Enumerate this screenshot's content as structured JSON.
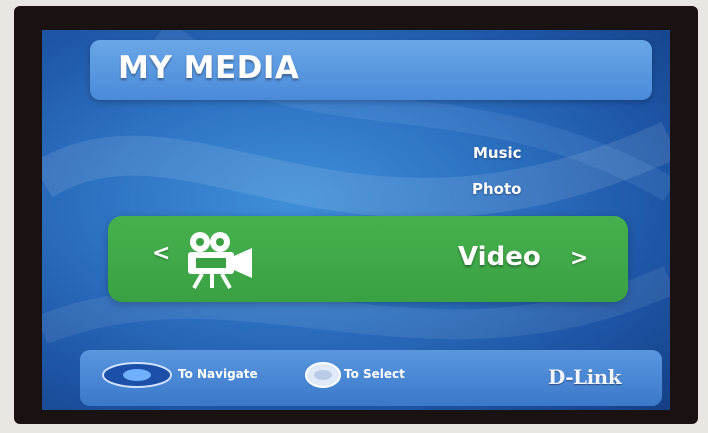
{
  "header": {
    "title": "MY MEDIA"
  },
  "menu": {
    "items": [
      {
        "label": "Music"
      },
      {
        "label": "Photo"
      },
      {
        "label": "Video",
        "selected": true,
        "icon": "video-camera-icon"
      }
    ],
    "prev_glyph": "<",
    "next_glyph": ">"
  },
  "footer": {
    "navigate_hint": "To Navigate",
    "select_hint": "To Select",
    "brand": "D-Link"
  },
  "colors": {
    "screen_blue": "#2f74c4",
    "selected_green": "#3aa143",
    "header_blue": "#5a97df"
  }
}
